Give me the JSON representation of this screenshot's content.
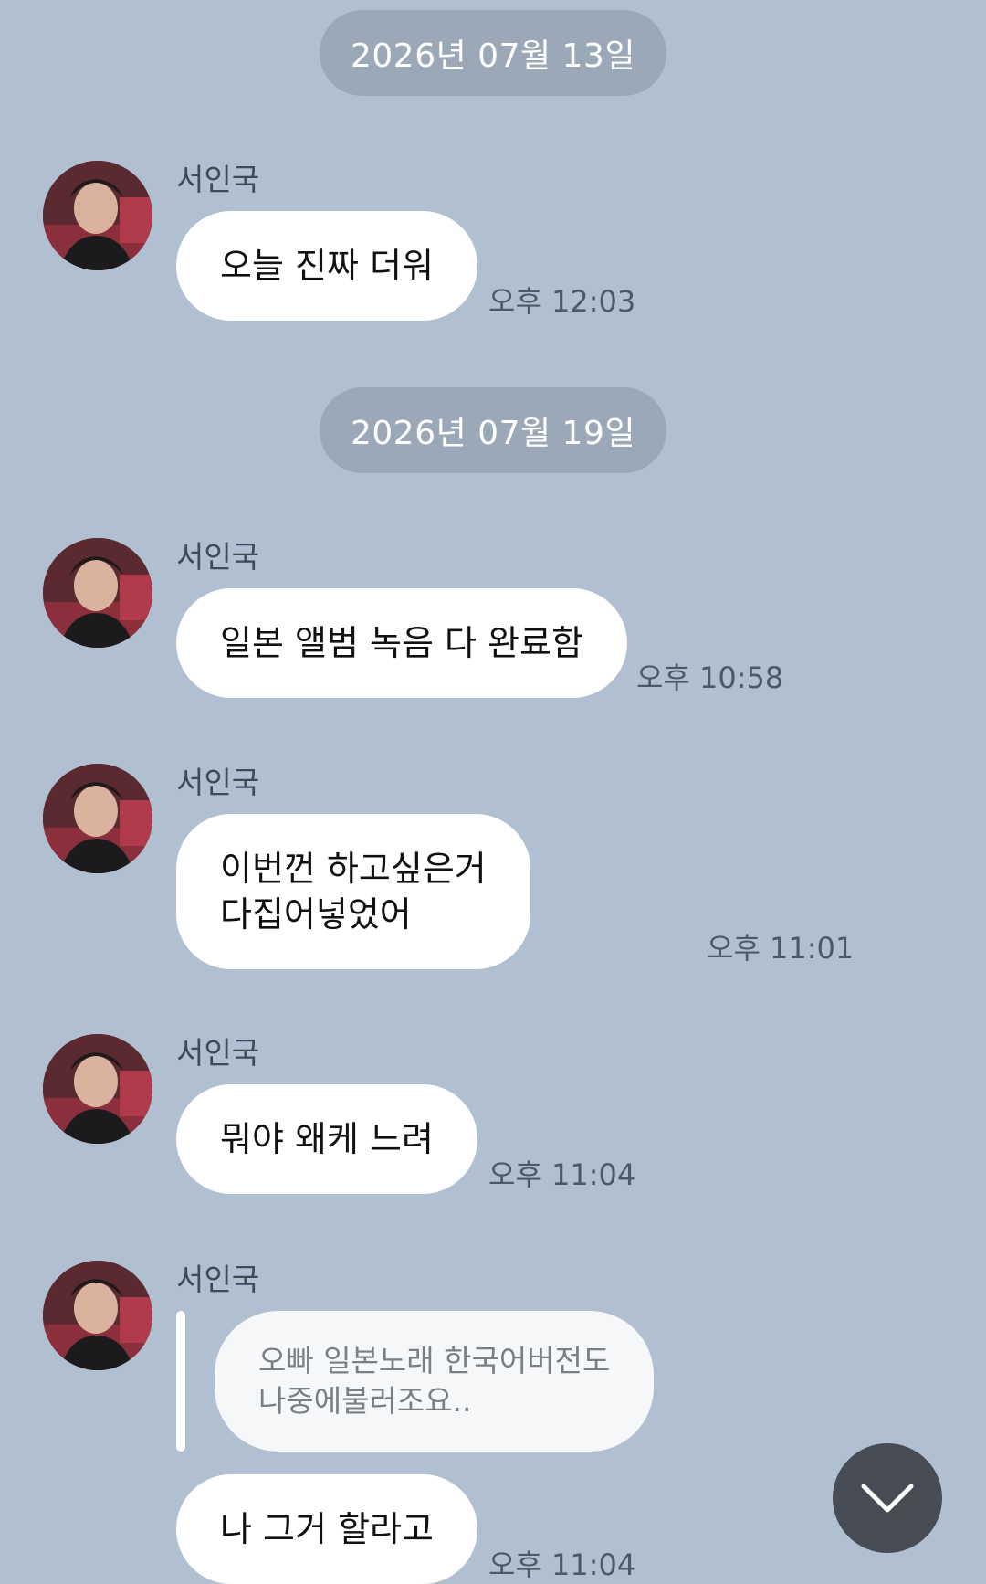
{
  "messages_view": {
    "sections": [
      {
        "date": "2026년 07월 13일",
        "messages": [
          {
            "sender": "서인국",
            "text": "오늘 진짜 더워",
            "time": "오후 12:03"
          }
        ]
      },
      {
        "date": "2026년 07월 19일",
        "messages": [
          {
            "sender": "서인국",
            "text": "일본 앨범 녹음 다 완료함",
            "time": "오후 10:58"
          },
          {
            "sender": "서인국",
            "text": "이번껀 하고싶은거\n다집어넣었어",
            "time": "오후 11:01"
          },
          {
            "sender": "서인국",
            "text": "뭐야 왜케 느려",
            "time": "오후 11:04"
          },
          {
            "sender": "서인국",
            "reply_to": "오빠 일본노래 한국어버전도\n나중에불러조요..",
            "text": "나 그거 할라고",
            "time": "오후 11:04"
          }
        ]
      }
    ]
  },
  "icons": {
    "avatar": "profile-photo",
    "scroll_down": "chevron-down-icon"
  },
  "colors": {
    "background": "#b1c0d0",
    "date_pill": "#9ba8b8",
    "bubble": "#ffffff",
    "reply_bubble": "#f6f7f9",
    "scroll_button": "#474c55"
  }
}
